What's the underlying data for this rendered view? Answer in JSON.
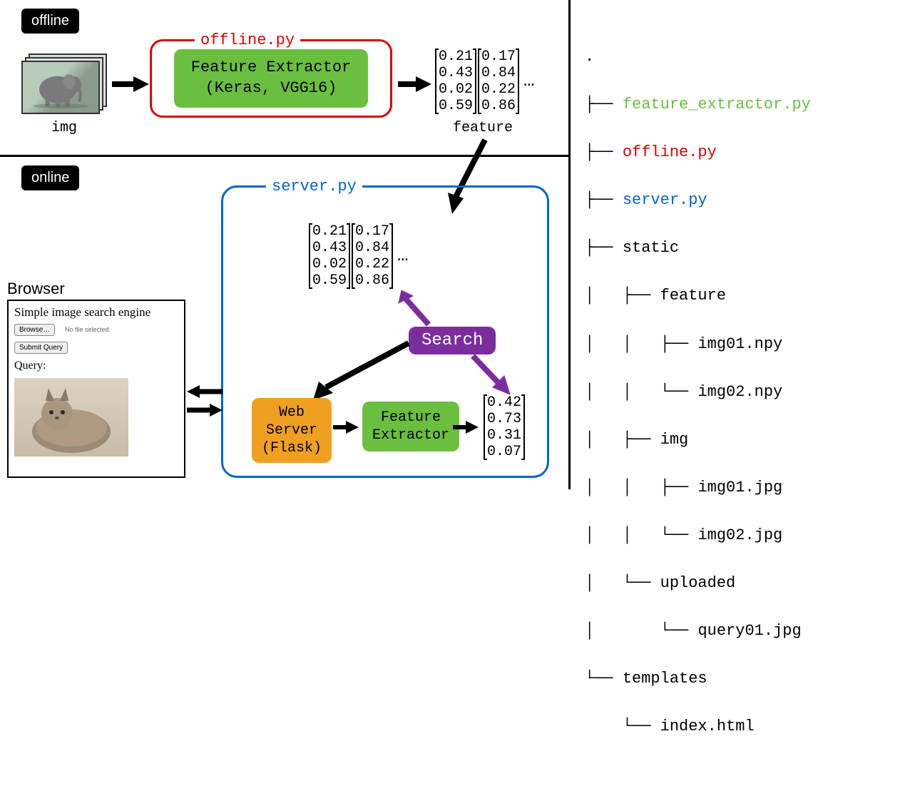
{
  "badges": {
    "offline": "offline",
    "online": "online"
  },
  "labels": {
    "img": "img",
    "feature": "feature",
    "browser": "Browser",
    "offline_py": "offline.py",
    "server_py": "server.py"
  },
  "boxes": {
    "feature_extractor_line1": "Feature Extractor",
    "feature_extractor_line2": "(Keras, VGG16)",
    "search": "Search",
    "webserver_line1": "Web",
    "webserver_line2": "Server",
    "webserver_line3": "(Flask)",
    "fe_small_line1": "Feature",
    "fe_small_line2": "Extractor"
  },
  "feature_vectors": {
    "offline_col1": [
      "0.21",
      "0.43",
      "0.02",
      "0.59"
    ],
    "offline_col2": [
      "0.17",
      "0.84",
      "0.22",
      "0.86"
    ],
    "ellipsis": "…",
    "online_col1": [
      "0.21",
      "0.43",
      "0.02",
      "0.59"
    ],
    "online_col2": [
      "0.17",
      "0.84",
      "0.22",
      "0.86"
    ],
    "query_vec": [
      "0.42",
      "0.73",
      "0.31",
      "0.07"
    ]
  },
  "browser": {
    "title": "Simple image search engine",
    "browse_btn": "Browse…",
    "no_file": "No file selected.",
    "submit_btn": "Submit Query",
    "query_label": "Query:"
  },
  "tree": {
    "root": ".",
    "feature_extractor": "feature_extractor.py",
    "offline": "offline.py",
    "server": "server.py",
    "static": "static",
    "feature_dir": "feature",
    "img01_npy": "img01.npy",
    "img02_npy": "img02.npy",
    "img_dir": "img",
    "img01_jpg": "img01.jpg",
    "img02_jpg": "img02.jpg",
    "uploaded": "uploaded",
    "query01": "query01.jpg",
    "templates": "templates",
    "index_html": "index.html"
  }
}
